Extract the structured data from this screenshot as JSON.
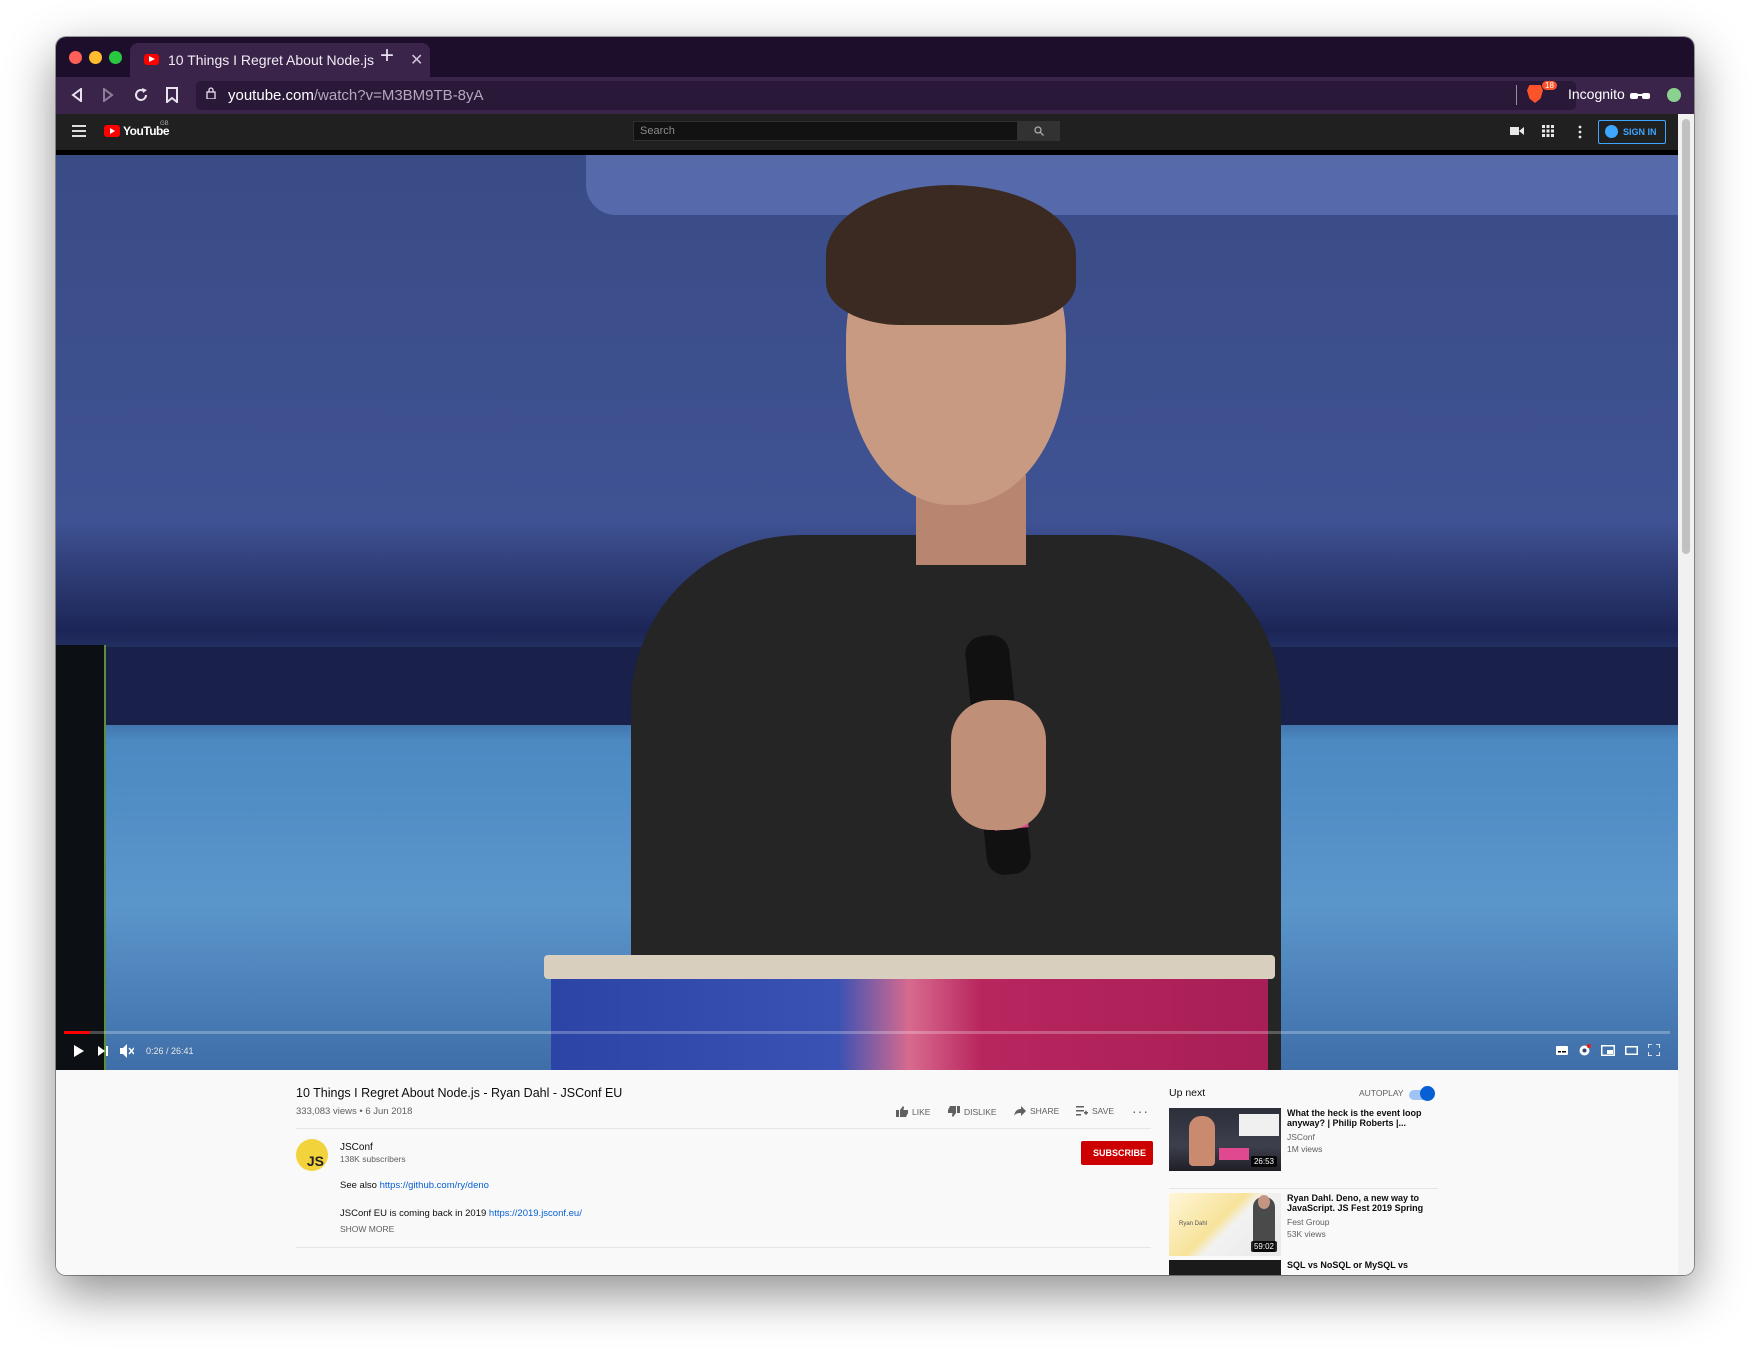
{
  "browser": {
    "tab_title": "10 Things I Regret About Node.js",
    "tab_close": "✕",
    "new_tab": "+",
    "url_host": "youtube.com",
    "url_path": "/watch?v=M3BM9TB-8yA",
    "shields_count": "18",
    "incognito_label": "Incognito",
    "colors": {
      "titlebar": "#1d0f2b",
      "toolbar": "#3a2449",
      "accent": "#fb542b"
    }
  },
  "youtube": {
    "logo_text": "YouTube",
    "region": "GB",
    "search_placeholder": "Search",
    "sign_in": "SIGN IN"
  },
  "player": {
    "current_time": "0:26",
    "duration": "26:41",
    "time_label": "0:26 / 26:41",
    "progress_fraction": 0.016
  },
  "video": {
    "title": "10 Things I Regret About Node.js - Ryan Dahl - JSConf EU",
    "meta": "333,083 views • 6 Jun 2018",
    "actions": {
      "like": "LIKE",
      "dislike": "DISLIKE",
      "share": "SHARE",
      "save": "SAVE",
      "more": "···"
    },
    "channel": {
      "avatar_text": "JS",
      "name": "JSConf",
      "subscribers": "138K subscribers",
      "subscribe": "SUBSCRIBE"
    },
    "description": {
      "line1_text": "See also ",
      "line1_link": "https://github.com/ry/deno",
      "line2_text": "JSConf EU is coming back in 2019 ",
      "line2_link": "https://2019.jsconf.eu/",
      "show_more": "SHOW MORE"
    }
  },
  "up_next": {
    "heading": "Up next",
    "autoplay_label": "AUTOPLAY",
    "autoplay_on": true,
    "items": [
      {
        "title": "What the heck is the event loop anyway? | Philip Roberts |...",
        "channel": "JSConf",
        "views": "1M views",
        "duration": "26:53"
      },
      {
        "title": "Ryan Dahl. Deno, a new way to JavaScript. JS Fest 2019 Spring",
        "channel": "Fest Group",
        "views": "53K views",
        "duration": "59:02",
        "thumb_caption": "Ryan Dahl"
      },
      {
        "title": "SQL vs NoSQL or MySQL vs"
      }
    ]
  }
}
